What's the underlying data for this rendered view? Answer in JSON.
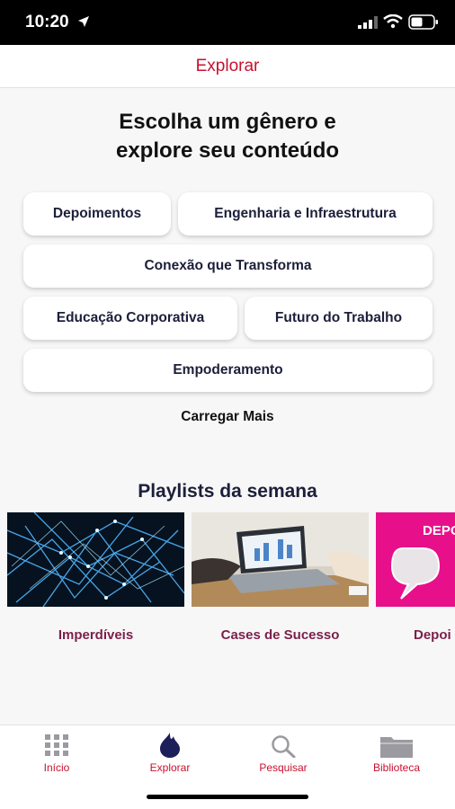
{
  "status_bar": {
    "time": "10:20"
  },
  "header": {
    "title": "Explorar"
  },
  "genres": {
    "heading_line1": "Escolha um gênero e",
    "heading_line2": "explore seu conteúdo",
    "items": [
      "Depoimentos",
      "Engenharia e Infraestrutura",
      "Conexão que Transforma",
      "Educação Corporativa",
      "Futuro do Trabalho",
      "Empoderamento"
    ],
    "load_more": "Carregar Mais"
  },
  "playlists": {
    "heading": "Playlists da semana",
    "items": [
      {
        "label": "Imperdíveis"
      },
      {
        "label": "Cases de Sucesso"
      },
      {
        "label": "Depoi",
        "thumb_text": "DEPOI"
      }
    ]
  },
  "tab_bar": {
    "items": [
      {
        "label": "Início",
        "icon": "grid-icon"
      },
      {
        "label": "Explorar",
        "icon": "flame-icon"
      },
      {
        "label": "Pesquisar",
        "icon": "search-icon"
      },
      {
        "label": "Biblioteca",
        "icon": "folder-icon"
      }
    ]
  },
  "colors": {
    "accent": "#c8102e",
    "playlist_label": "#7a1f4a",
    "chip_text": "#1c1f3a"
  }
}
